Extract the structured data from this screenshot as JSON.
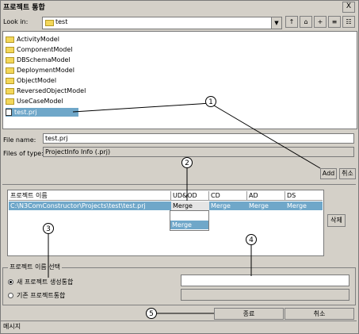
{
  "window": {
    "title": "프로젝트 통합",
    "close_label": "X"
  },
  "lookin": {
    "label": "Look in:",
    "value": "test"
  },
  "files": [
    "ActivityModel",
    "ComponentModel",
    "DBSchemaModel",
    "DeploymentModel",
    "ObjectModel",
    "ReversedObjectModel",
    "UseCaseModel",
    "test.prj"
  ],
  "filename": {
    "label": "File name:",
    "value": "test.prj"
  },
  "filetype": {
    "label": "Files of type:",
    "value": "ProjectInfo Info (.prj)"
  },
  "buttons": {
    "add": "Add",
    "cancel_small": "취소",
    "delete": "삭제",
    "finish": "종료",
    "cancel": "취소"
  },
  "table": {
    "headers": [
      "프로젝트 이름",
      "UD&OD",
      "CD",
      "AD",
      "DS"
    ],
    "row": [
      "C:\\N3ComConstructor\\Projects\\test\\test.prj",
      "Merge",
      "Merge",
      "Merge",
      "Merge"
    ],
    "dropdown_options": [
      "",
      "Merge"
    ]
  },
  "group": {
    "title": "프로젝트 이름 선택",
    "radio_new": "새 프로젝트 생성통합",
    "radio_existing": "기존 프로젝트통합",
    "radio_new_selected": true
  },
  "status": "메시지",
  "callouts": [
    "1",
    "2",
    "3",
    "4",
    "5"
  ]
}
